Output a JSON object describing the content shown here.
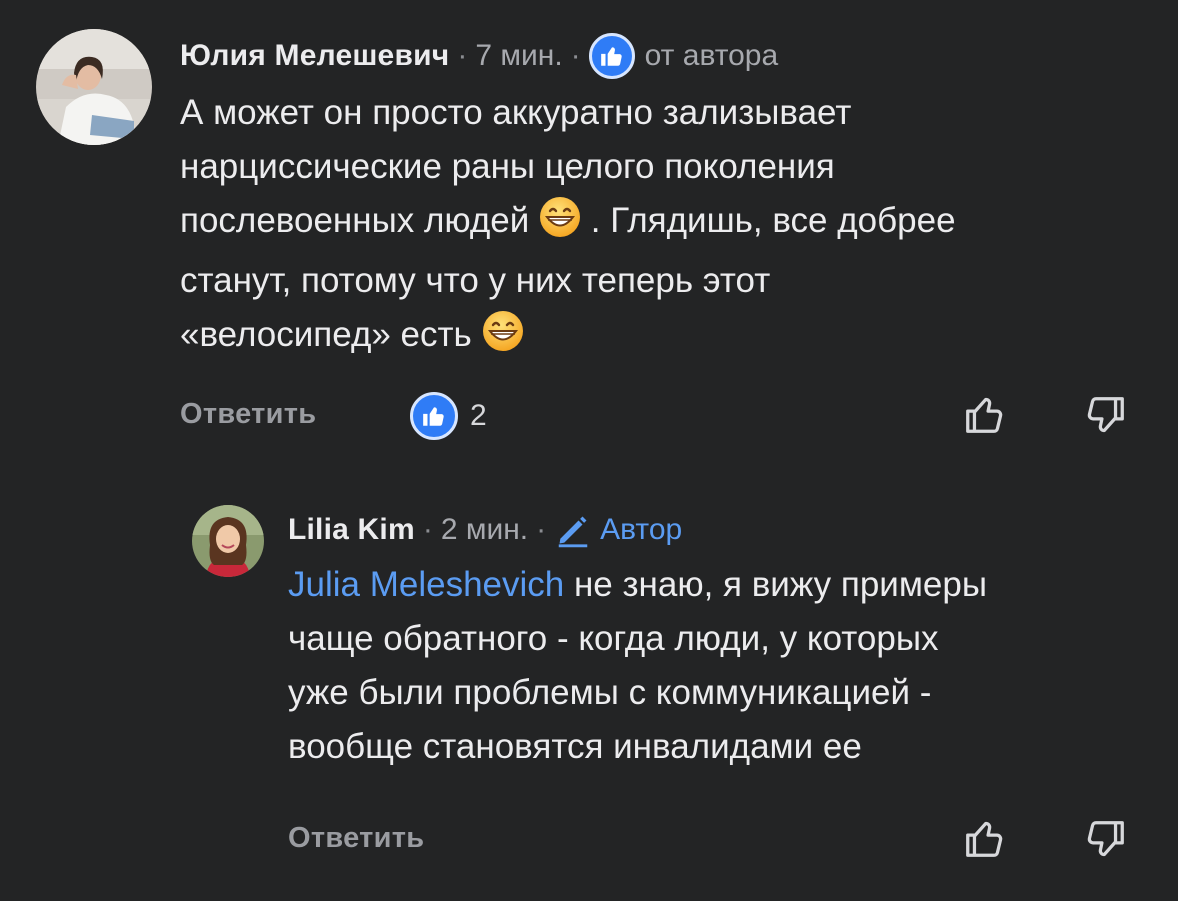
{
  "comment": {
    "author": "Юлия Мелешевич",
    "separator": "·",
    "time": "7 мин.",
    "badge_icon": "thumbs-up-icon",
    "badge_label": "от автора",
    "lines": [
      "А может он просто аккуратно зализывает",
      "нарциссические раны целого поколения",
      "послевоенных людей",
      ". Глядишь, все добрее",
      "станут, потому что у них теперь этот",
      "«велосипед» есть"
    ],
    "reply_label": "Ответить",
    "like_count": "2"
  },
  "reply": {
    "author": "Lilia Kim",
    "separator": "·",
    "time": "2 мин.",
    "author_tag_icon": "pencil-icon",
    "author_tag": "Автор",
    "mention": "Julia Meleshevich",
    "lines": [
      " не знаю, я вижу примеры",
      "чаще обратного - когда люди, у которых",
      "уже были проблемы с коммуникацией -",
      "вообще становятся инвалидами ее"
    ],
    "reply_label": "Ответить"
  },
  "colors": {
    "background": "#232425",
    "accent": "#5b9cf2",
    "like_badge": "#2f7cf6"
  }
}
